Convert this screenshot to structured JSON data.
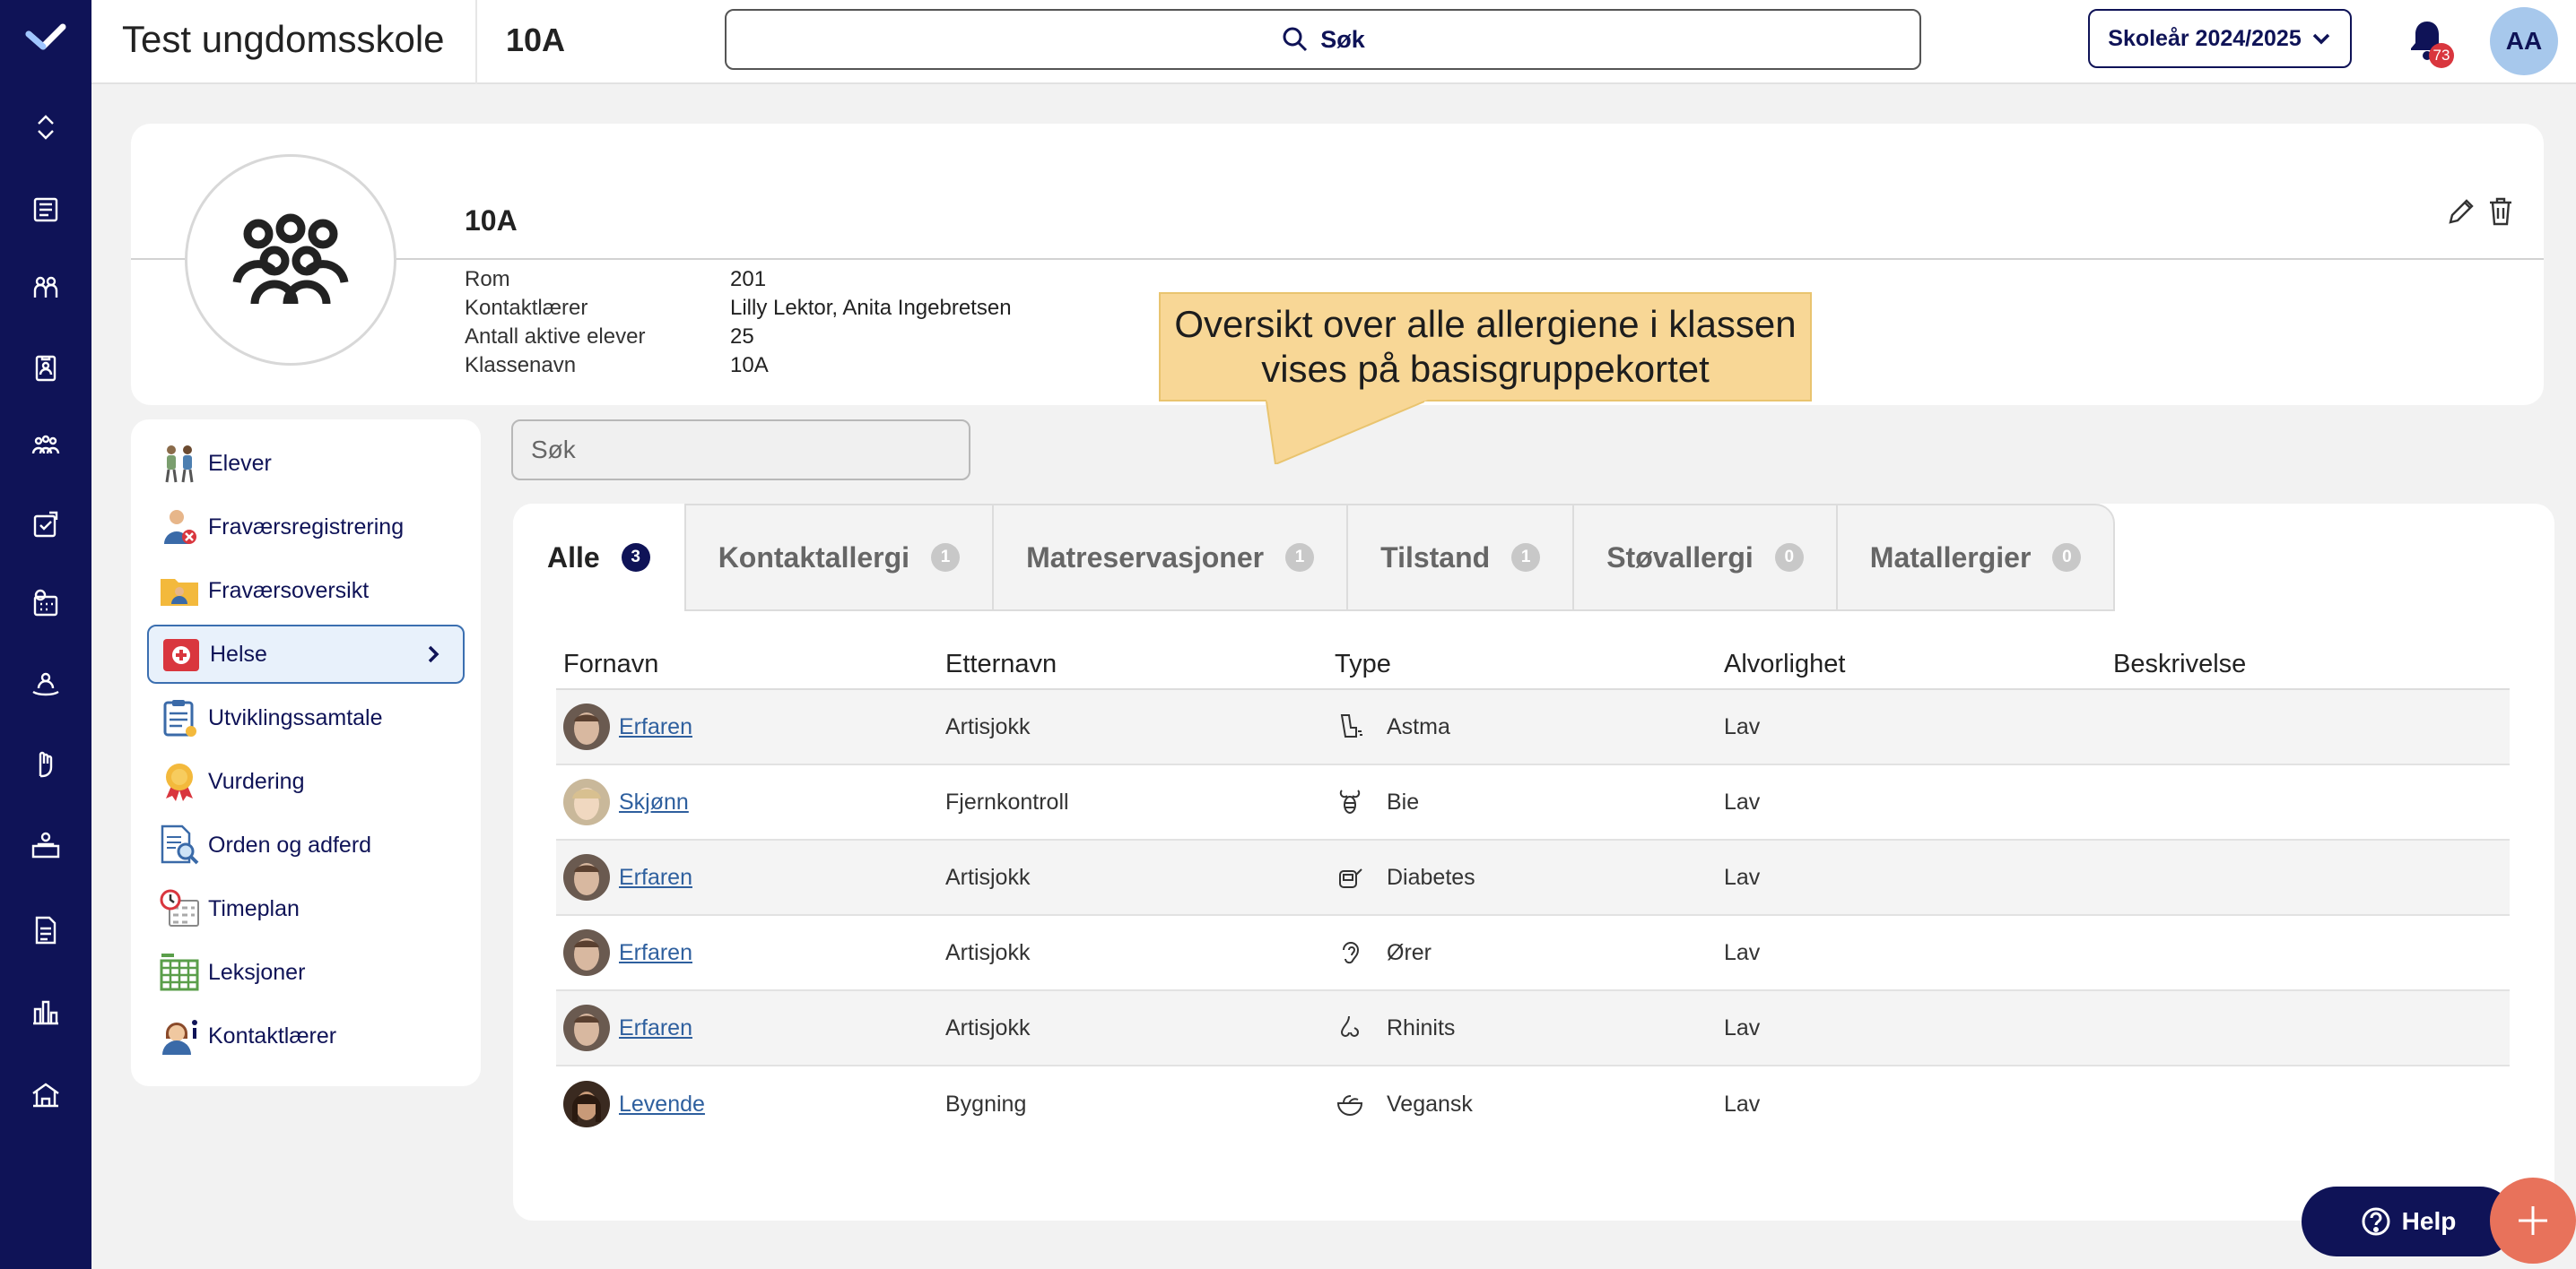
{
  "topbar": {
    "school_name": "Test ungdomsskole",
    "class_name": "10A",
    "search_label": "Søk",
    "school_year_label": "Skoleår 2024/2025",
    "notification_count": "73",
    "user_initials": "AA"
  },
  "header": {
    "title": "10A",
    "fields": [
      {
        "label": "Rom",
        "value": "201"
      },
      {
        "label": "Kontaktlærer",
        "value": "Lilly Lektor, Anita Ingebretsen"
      },
      {
        "label": "Antall aktive elever",
        "value": "25"
      },
      {
        "label": "Klassenavn",
        "value": "10A"
      }
    ]
  },
  "callout": {
    "text": "Oversikt over alle allergiene i klassen vises på basisgruppekortet"
  },
  "side_menu": {
    "items": [
      {
        "label": "Elever"
      },
      {
        "label": "Fraværsregistrering"
      },
      {
        "label": "Fraværsoversikt"
      },
      {
        "label": "Helse"
      },
      {
        "label": "Utviklingssamtale"
      },
      {
        "label": "Vurdering"
      },
      {
        "label": "Orden og adferd"
      },
      {
        "label": "Timeplan"
      },
      {
        "label": "Leksjoner"
      },
      {
        "label": "Kontaktlærer"
      }
    ]
  },
  "search": {
    "placeholder": "Søk"
  },
  "tabs": [
    {
      "label": "Alle",
      "count": "3"
    },
    {
      "label": "Kontaktallergi",
      "count": "1"
    },
    {
      "label": "Matreservasjoner",
      "count": "1"
    },
    {
      "label": "Tilstand",
      "count": "1"
    },
    {
      "label": "Støvallergi",
      "count": "0"
    },
    {
      "label": "Matallergier",
      "count": "0"
    }
  ],
  "table": {
    "headers": [
      "Fornavn",
      "Etternavn",
      "Type",
      "Alvorlighet",
      "Beskrivelse"
    ],
    "rows": [
      {
        "first": "Erfaren",
        "last": "Artisjokk",
        "type": "Astma",
        "type_icon": "inhaler-icon",
        "severity": "Lav",
        "description": ""
      },
      {
        "first": "Skjønn",
        "last": "Fjernkontroll",
        "type": "Bie",
        "type_icon": "bee-icon",
        "severity": "Lav",
        "description": ""
      },
      {
        "first": "Erfaren",
        "last": "Artisjokk",
        "type": "Diabetes",
        "type_icon": "glucose-meter-icon",
        "severity": "Lav",
        "description": ""
      },
      {
        "first": "Erfaren",
        "last": "Artisjokk",
        "type": "Ører",
        "type_icon": "ear-icon",
        "severity": "Lav",
        "description": ""
      },
      {
        "first": "Erfaren",
        "last": "Artisjokk",
        "type": "Rhinits",
        "type_icon": "nose-icon",
        "severity": "Lav",
        "description": ""
      },
      {
        "first": "Levende",
        "last": "Bygning",
        "type": "Vegansk",
        "type_icon": "salad-bowl-icon",
        "severity": "Lav",
        "description": ""
      }
    ]
  },
  "buttons": {
    "help_label": "Help"
  },
  "colors": {
    "navy": "#0f1357",
    "callout": "#f8d796",
    "fab": "#e8725b",
    "badge": "#d9363e"
  }
}
